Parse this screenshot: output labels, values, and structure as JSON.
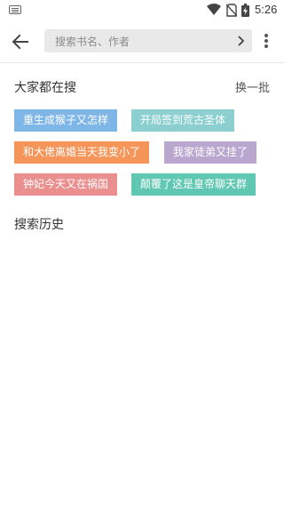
{
  "status_bar": {
    "time": "5:26",
    "icons": [
      "keyboard-icon",
      "wifi-icon",
      "no-sim-icon",
      "battery-charging-icon"
    ]
  },
  "toolbar": {
    "back_icon": "arrow-left-icon",
    "search_placeholder": "搜索书名、作者",
    "search_value": "",
    "go_icon": "chevron-right-icon",
    "more_icon": "more-vertical-icon"
  },
  "hot_section": {
    "title": "大家都在搜",
    "refresh_label": "换一批",
    "tags": [
      {
        "label": "重生成猴子又怎样",
        "color": "#7fb6e8"
      },
      {
        "label": "开局签到荒古圣体",
        "color": "#8ccfd0"
      },
      {
        "label": "和大佬离婚当天我变小了",
        "color": "#f5955a"
      },
      {
        "label": "我家徒弟又挂了",
        "color": "#b9a7d0"
      },
      {
        "label": "钟妃今天又在祸国",
        "color": "#ea8e8e"
      },
      {
        "label": "颠覆了这是皇帝聊天群",
        "color": "#5fc7b2"
      }
    ]
  },
  "history_section": {
    "title": "搜索历史"
  }
}
